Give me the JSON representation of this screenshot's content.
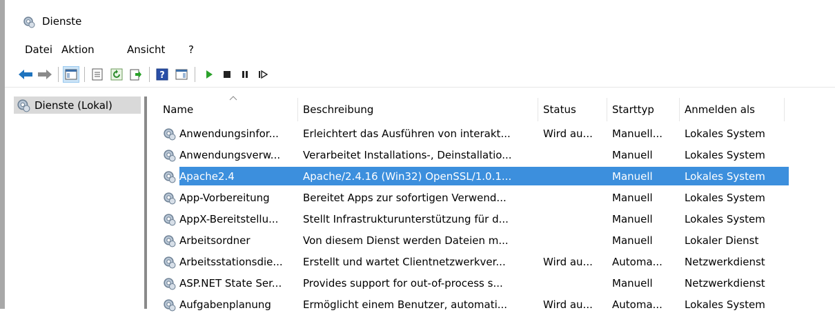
{
  "window": {
    "title": "Dienste"
  },
  "menu": [
    "Datei",
    "Aktion",
    "Ansicht",
    "?"
  ],
  "tree": {
    "item": "Dienste (Lokal)"
  },
  "columns": [
    "Name",
    "Beschreibung",
    "Status",
    "Starttyp",
    "Anmelden als"
  ],
  "rows": [
    {
      "name": "Anwendungsinfor...",
      "desc": "Erleichtert das Ausführen von interakt...",
      "status": "Wird au...",
      "start": "Manuell...",
      "logon": "Lokales System"
    },
    {
      "name": "Anwendungsverw...",
      "desc": "Verarbeitet Installations-, Deinstallatio...",
      "status": "",
      "start": "Manuell",
      "logon": "Lokales System"
    },
    {
      "name": "Apache2.4",
      "desc": "Apache/2.4.16 (Win32) OpenSSL/1.0.1...",
      "status": "",
      "start": "Manuell",
      "logon": "Lokales System",
      "selected": true
    },
    {
      "name": "App-Vorbereitung",
      "desc": "Bereitet Apps zur sofortigen Verwend...",
      "status": "",
      "start": "Manuell",
      "logon": "Lokales System"
    },
    {
      "name": "AppX-Bereitstellu...",
      "desc": "Stellt Infrastrukturunterstützung für d...",
      "status": "",
      "start": "Manuell",
      "logon": "Lokales System"
    },
    {
      "name": "Arbeitsordner",
      "desc": "Von diesem Dienst werden Dateien m...",
      "status": "",
      "start": "Manuell",
      "logon": "Lokaler Dienst"
    },
    {
      "name": "Arbeitsstationsdie...",
      "desc": "Erstellt und wartet Clientnetzwerkver...",
      "status": "Wird au...",
      "start": "Automa...",
      "logon": "Netzwerkdienst"
    },
    {
      "name": "ASP.NET State Ser...",
      "desc": "Provides support for out-of-process s...",
      "status": "",
      "start": "Manuell",
      "logon": "Netzwerkdienst"
    },
    {
      "name": "Aufgabenplanung",
      "desc": "Ermöglicht einem Benutzer, automati...",
      "status": "Wird au...",
      "start": "Automa...",
      "logon": "Lokales System"
    }
  ],
  "toolbar": [
    "back-icon",
    "forward-icon",
    "show-hide-console-tree-icon",
    "properties-icon",
    "refresh-icon",
    "export-list-icon",
    "help-icon",
    "show-hide-action-pane-icon",
    "start-service-icon",
    "stop-service-icon",
    "pause-service-icon",
    "resume-service-icon"
  ],
  "colors": {
    "selection": "#3c8fdd",
    "tree_selected": "#d9d9d9",
    "accent_blue": "#1e73be",
    "play_green": "#2aa12a"
  }
}
